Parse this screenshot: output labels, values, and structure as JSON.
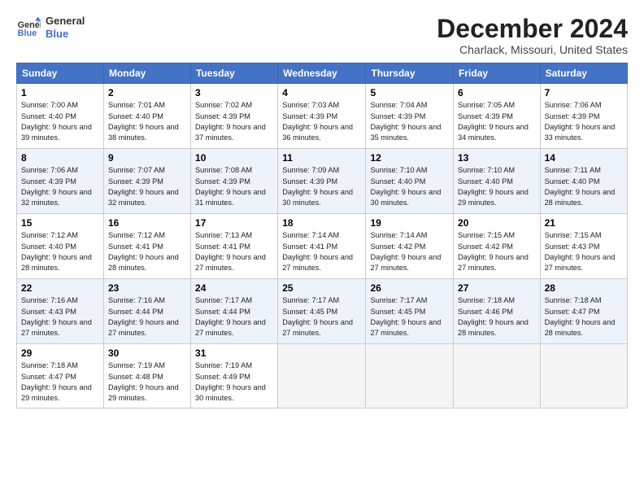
{
  "header": {
    "logo_line1": "General",
    "logo_line2": "Blue",
    "title": "December 2024",
    "subtitle": "Charlack, Missouri, United States"
  },
  "weekdays": [
    "Sunday",
    "Monday",
    "Tuesday",
    "Wednesday",
    "Thursday",
    "Friday",
    "Saturday"
  ],
  "weeks": [
    [
      {
        "day": "1",
        "sunrise": "7:00 AM",
        "sunset": "4:40 PM",
        "daylight": "9 hours and 39 minutes."
      },
      {
        "day": "2",
        "sunrise": "7:01 AM",
        "sunset": "4:40 PM",
        "daylight": "9 hours and 38 minutes."
      },
      {
        "day": "3",
        "sunrise": "7:02 AM",
        "sunset": "4:39 PM",
        "daylight": "9 hours and 37 minutes."
      },
      {
        "day": "4",
        "sunrise": "7:03 AM",
        "sunset": "4:39 PM",
        "daylight": "9 hours and 36 minutes."
      },
      {
        "day": "5",
        "sunrise": "7:04 AM",
        "sunset": "4:39 PM",
        "daylight": "9 hours and 35 minutes."
      },
      {
        "day": "6",
        "sunrise": "7:05 AM",
        "sunset": "4:39 PM",
        "daylight": "9 hours and 34 minutes."
      },
      {
        "day": "7",
        "sunrise": "7:06 AM",
        "sunset": "4:39 PM",
        "daylight": "9 hours and 33 minutes."
      }
    ],
    [
      {
        "day": "8",
        "sunrise": "7:06 AM",
        "sunset": "4:39 PM",
        "daylight": "9 hours and 32 minutes."
      },
      {
        "day": "9",
        "sunrise": "7:07 AM",
        "sunset": "4:39 PM",
        "daylight": "9 hours and 32 minutes."
      },
      {
        "day": "10",
        "sunrise": "7:08 AM",
        "sunset": "4:39 PM",
        "daylight": "9 hours and 31 minutes."
      },
      {
        "day": "11",
        "sunrise": "7:09 AM",
        "sunset": "4:39 PM",
        "daylight": "9 hours and 30 minutes."
      },
      {
        "day": "12",
        "sunrise": "7:10 AM",
        "sunset": "4:40 PM",
        "daylight": "9 hours and 30 minutes."
      },
      {
        "day": "13",
        "sunrise": "7:10 AM",
        "sunset": "4:40 PM",
        "daylight": "9 hours and 29 minutes."
      },
      {
        "day": "14",
        "sunrise": "7:11 AM",
        "sunset": "4:40 PM",
        "daylight": "9 hours and 28 minutes."
      }
    ],
    [
      {
        "day": "15",
        "sunrise": "7:12 AM",
        "sunset": "4:40 PM",
        "daylight": "9 hours and 28 minutes."
      },
      {
        "day": "16",
        "sunrise": "7:12 AM",
        "sunset": "4:41 PM",
        "daylight": "9 hours and 28 minutes."
      },
      {
        "day": "17",
        "sunrise": "7:13 AM",
        "sunset": "4:41 PM",
        "daylight": "9 hours and 27 minutes."
      },
      {
        "day": "18",
        "sunrise": "7:14 AM",
        "sunset": "4:41 PM",
        "daylight": "9 hours and 27 minutes."
      },
      {
        "day": "19",
        "sunrise": "7:14 AM",
        "sunset": "4:42 PM",
        "daylight": "9 hours and 27 minutes."
      },
      {
        "day": "20",
        "sunrise": "7:15 AM",
        "sunset": "4:42 PM",
        "daylight": "9 hours and 27 minutes."
      },
      {
        "day": "21",
        "sunrise": "7:15 AM",
        "sunset": "4:43 PM",
        "daylight": "9 hours and 27 minutes."
      }
    ],
    [
      {
        "day": "22",
        "sunrise": "7:16 AM",
        "sunset": "4:43 PM",
        "daylight": "9 hours and 27 minutes."
      },
      {
        "day": "23",
        "sunrise": "7:16 AM",
        "sunset": "4:44 PM",
        "daylight": "9 hours and 27 minutes."
      },
      {
        "day": "24",
        "sunrise": "7:17 AM",
        "sunset": "4:44 PM",
        "daylight": "9 hours and 27 minutes."
      },
      {
        "day": "25",
        "sunrise": "7:17 AM",
        "sunset": "4:45 PM",
        "daylight": "9 hours and 27 minutes."
      },
      {
        "day": "26",
        "sunrise": "7:17 AM",
        "sunset": "4:45 PM",
        "daylight": "9 hours and 27 minutes."
      },
      {
        "day": "27",
        "sunrise": "7:18 AM",
        "sunset": "4:46 PM",
        "daylight": "9 hours and 28 minutes."
      },
      {
        "day": "28",
        "sunrise": "7:18 AM",
        "sunset": "4:47 PM",
        "daylight": "9 hours and 28 minutes."
      }
    ],
    [
      {
        "day": "29",
        "sunrise": "7:18 AM",
        "sunset": "4:47 PM",
        "daylight": "9 hours and 29 minutes."
      },
      {
        "day": "30",
        "sunrise": "7:19 AM",
        "sunset": "4:48 PM",
        "daylight": "9 hours and 29 minutes."
      },
      {
        "day": "31",
        "sunrise": "7:19 AM",
        "sunset": "4:49 PM",
        "daylight": "9 hours and 30 minutes."
      },
      null,
      null,
      null,
      null
    ]
  ],
  "labels": {
    "sunrise": "Sunrise:",
    "sunset": "Sunset:",
    "daylight": "Daylight:"
  }
}
